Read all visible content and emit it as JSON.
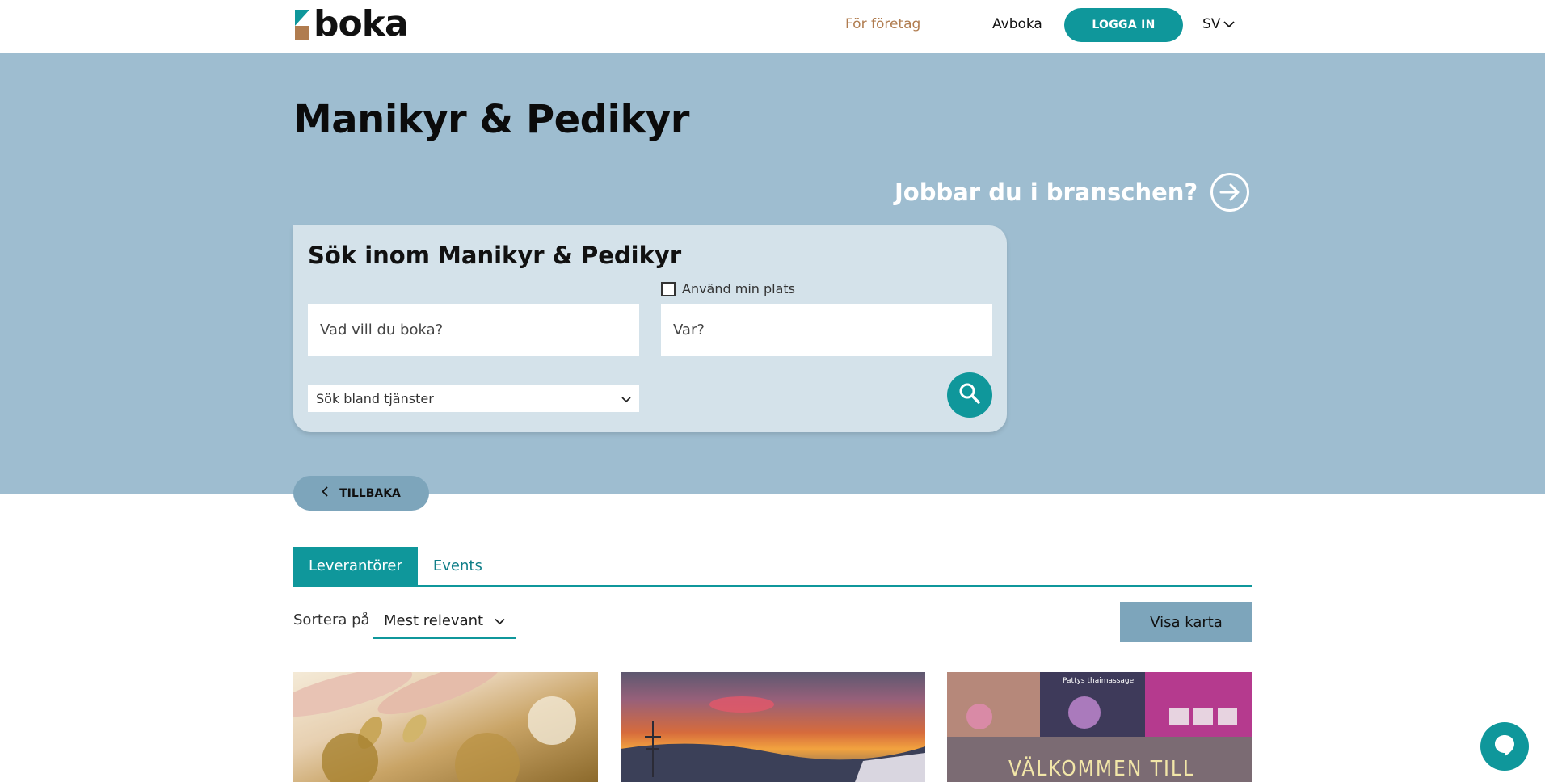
{
  "header": {
    "logo_text": "boka",
    "nav_business": "För företag",
    "nav_cancel": "Avboka",
    "login_label": "LOGGA IN",
    "language": "SV"
  },
  "hero": {
    "title": "Manikyr & Pedikyr",
    "industry_link": "Jobbar du i branschen?"
  },
  "search": {
    "title": "Sök inom Manikyr & Pedikyr",
    "use_location_label": "Använd min plats",
    "what_placeholder": "Vad vill du boka?",
    "where_placeholder": "Var?",
    "service_select_label": "Sök bland tjänster"
  },
  "back_label": "TILLBAKA",
  "tabs": [
    {
      "label": "Leverantörer",
      "active": true
    },
    {
      "label": "Events",
      "active": false
    }
  ],
  "sort": {
    "label": "Sortera på",
    "selected": "Mest relevant"
  },
  "map_button_label": "Visa karta",
  "cards": [
    {
      "image": "manicured-nails-photo"
    },
    {
      "image": "sunset-landscape-photo"
    },
    {
      "image": "salon-collage-photo",
      "overlay_text": "VÄLKOMMEN TILL",
      "badge_text": "Pattys thaimassage"
    }
  ],
  "colors": {
    "teal": "#0f979b",
    "hero_bg": "#9ebdd0",
    "card_bg": "#d4e2ea",
    "muted_button": "#7da5bb",
    "business_link": "#b07c4f"
  }
}
